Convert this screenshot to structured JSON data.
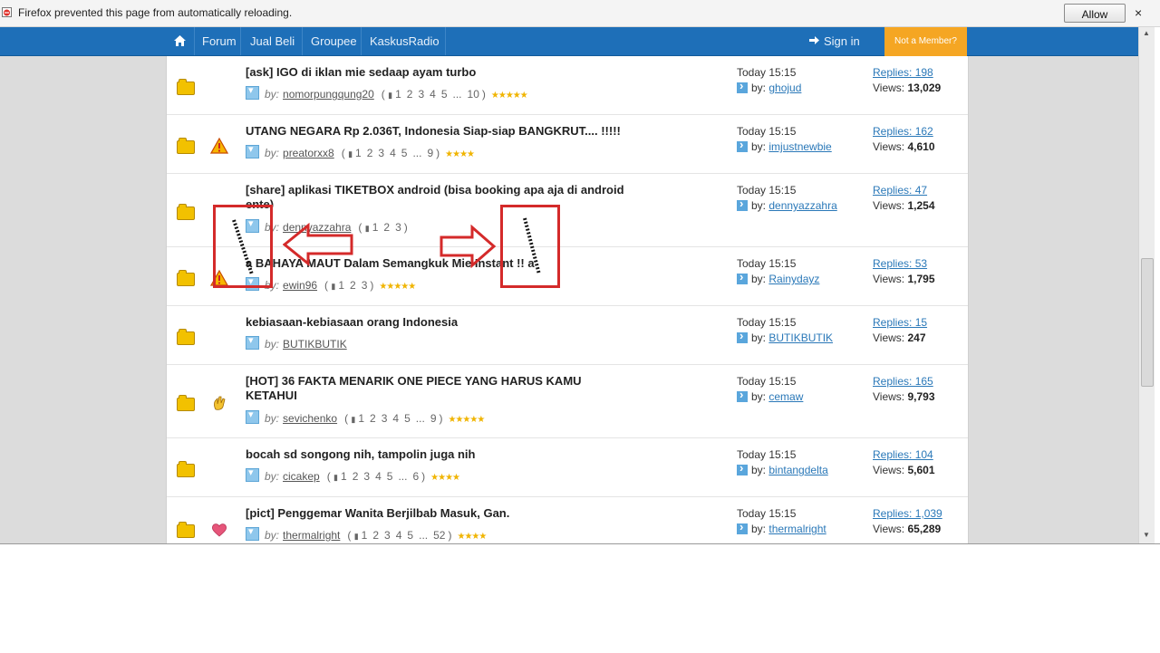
{
  "notification": {
    "message": "Firefox prevented this page from automatically reloading.",
    "allow_label": "Allow",
    "close_label": "×"
  },
  "nav": {
    "items": [
      "Forum",
      "Jual Beli",
      "Groupee",
      "KaskusRadio"
    ],
    "signin_label": "Sign in",
    "member_label": "Not a Member?"
  },
  "threads": [
    {
      "title": "[ask] IGO di iklan mie sedaap ayam turbo",
      "user": "nomorpungqung20",
      "pages": [
        "1",
        "2",
        "3",
        "4",
        "5",
        "...",
        "10"
      ],
      "stars": "★★★★★",
      "tag": "",
      "last_time": "Today 15:15",
      "last_user": "ghojud",
      "replies": "Replies: 198",
      "views_label": "Views:",
      "views": "13,029"
    },
    {
      "title": "UTANG NEGARA Rp 2.036T, Indonesia Siap-siap BANGKRUT.... !!!!!",
      "user": "preatorxx8",
      "pages": [
        "1",
        "2",
        "3",
        "4",
        "5",
        "...",
        "9"
      ],
      "stars": "★★★★",
      "tag": "warning",
      "last_time": "Today 15:15",
      "last_user": "imjustnewbie",
      "replies": "Replies: 162",
      "views_label": "Views:",
      "views": "4,610"
    },
    {
      "title": "[share] aplikasi TIKETBOX android (bisa booking apa aja di android ente)",
      "user": "dennyazzahra",
      "pages": [
        "1",
        "2",
        "3"
      ],
      "stars": "",
      "tag": "",
      "last_time": "Today 15:15",
      "last_user": "dennyazzahra",
      "replies": "Replies: 47",
      "views_label": "Views:",
      "views": "1,254"
    },
    {
      "title": "a BAHAYA MAUT Dalam Semangkuk Mie Instant !! a",
      "user": "ewin96",
      "pages": [
        "1",
        "2",
        "3"
      ],
      "stars": "★★★★★",
      "tag": "warning",
      "last_time": "Today 15:15",
      "last_user": "Rainydayz",
      "replies": "Replies: 53",
      "views_label": "Views:",
      "views": "1,795"
    },
    {
      "title": "kebiasaan-kebiasaan orang Indonesia",
      "user": "BUTIKBUTIK",
      "pages": [],
      "stars": "",
      "tag": "",
      "last_time": "Today 15:15",
      "last_user": "BUTIKBUTIK",
      "replies": "Replies: 15",
      "views_label": "Views:",
      "views": "247"
    },
    {
      "title": "[HOT] 36 FAKTA MENARIK ONE PIECE YANG HARUS KAMU KETAHUI",
      "user": "sevichenko",
      "pages": [
        "1",
        "2",
        "3",
        "4",
        "5",
        "...",
        "9"
      ],
      "stars": "★★★★★",
      "tag": "hot",
      "last_time": "Today 15:15",
      "last_user": "cemaw",
      "replies": "Replies: 165",
      "views_label": "Views:",
      "views": "9,793"
    },
    {
      "title": "bocah sd songong nih, tampolin juga nih",
      "user": "cicakep",
      "pages": [
        "1",
        "2",
        "3",
        "4",
        "5",
        "...",
        "6"
      ],
      "stars": "★★★★",
      "tag": "",
      "last_time": "Today 15:15",
      "last_user": "bintangdelta",
      "replies": "Replies: 104",
      "views_label": "Views:",
      "views": "5,601"
    },
    {
      "title": "[pict] Penggemar Wanita Berjilbab Masuk, Gan.",
      "user": "thermalright",
      "pages": [
        "1",
        "2",
        "3",
        "4",
        "5",
        "...",
        "52"
      ],
      "stars": "★★★★",
      "tag": "heart",
      "last_time": "Today 15:15",
      "last_user": "thermalright",
      "replies": "Replies: 1,039",
      "views_label": "Views:",
      "views": "65,289"
    }
  ],
  "labels": {
    "by": "by:"
  },
  "colors": {
    "nav_bg": "#1e6fb8",
    "member_bg": "#f5a623",
    "annotation": "#d42a2a",
    "link": "#2a78b8"
  }
}
